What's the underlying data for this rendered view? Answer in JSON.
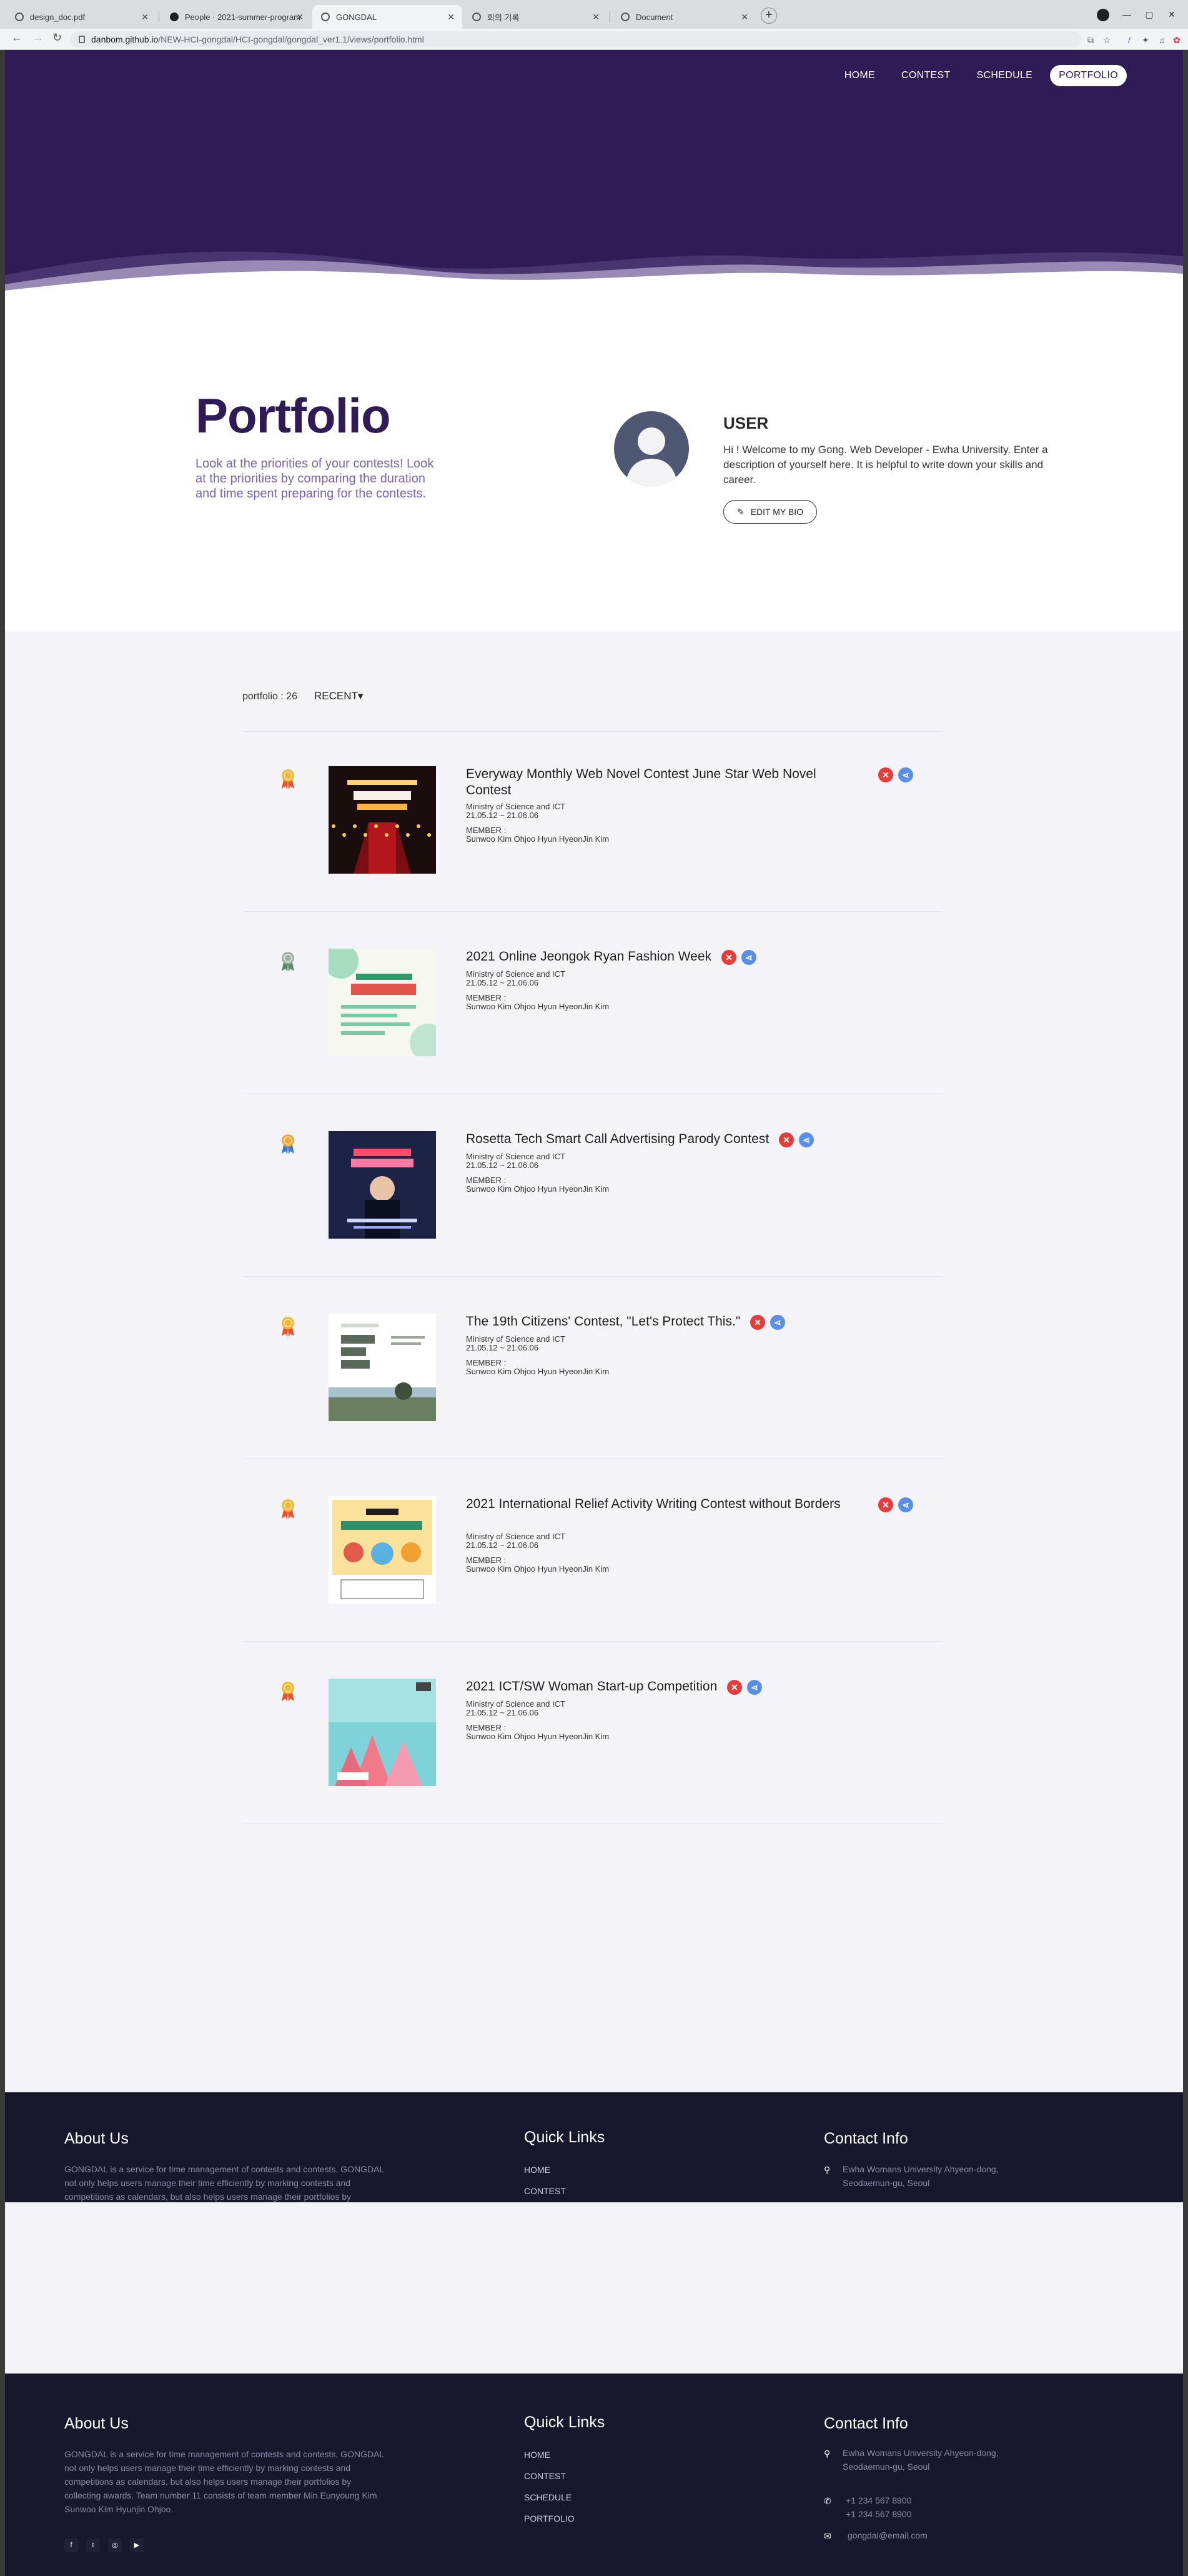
{
  "browser": {
    "tabs": [
      {
        "label": "design_doc.pdf",
        "active": false
      },
      {
        "label": "People · 2021-summer-program",
        "active": false
      },
      {
        "label": "GONGDAL",
        "active": true
      },
      {
        "label": "회의 기록",
        "active": false
      },
      {
        "label": "Document",
        "active": false
      }
    ],
    "url_host": "danbom.github.io",
    "url_path": "/NEW-HCI-gongdal/HCI-gongdal/gongdal_ver1.1/views/portfolio.html"
  },
  "nav": {
    "items": [
      "HOME",
      "CONTEST",
      "SCHEDULE",
      "PORTFOLIO"
    ],
    "active": "PORTFOLIO"
  },
  "header": {
    "title": "Portfolio",
    "description": "Look at the priorities of your contests! Look at the priorities by comparing the duration and time spent preparing for the contests."
  },
  "profile": {
    "name": "USER",
    "bio": "Hi ! Welcome to my Gong. Web Developer - Ewha University. Enter a description of yourself here. It is helpful to write down your skills and career.",
    "edit_label": "EDIT MY BIO"
  },
  "list": {
    "count_label": "portfolio : 26",
    "sort_label": "RECENT▾"
  },
  "items": [
    {
      "title": "Everyway Monthly Web Novel Contest June Star Web Novel Contest",
      "org": "Ministry of Science and ICT",
      "dates": "21.05.12 ~ 21.06.06",
      "member_label": "MEMBER :",
      "members": "Sunwoo Kim Ohjoo Hyun HyeonJin Kim",
      "medal": "gold",
      "thumb": "novel",
      "thumb_caption": "무료 웹소설 공모전"
    },
    {
      "title": "2021 Online Jeongok Ryan Fashion Week",
      "org": "Ministry of Science and ICT",
      "dates": "21.05.12 ~ 21.06.06",
      "member_label": "MEMBER :",
      "members": "Sunwoo Kim Ohjoo Hyun HyeonJin Kim",
      "medal": "silver",
      "thumb": "fashion",
      "thumb_caption": "전곡리안 패션위크"
    },
    {
      "title": "Rosetta Tech Smart Call Advertising Parody Contest",
      "org": "Ministry of Science and ICT",
      "dates": "21.05.12 ~ 21.06.06",
      "member_label": "MEMBER :",
      "members": "Sunwoo Kim Ohjoo Hyun HyeonJin Kim",
      "medal": "bronze",
      "thumb": "parody",
      "thumb_caption": "패러디 콘테스트"
    },
    {
      "title": "The 19th Citizens' Contest, \"Let's Protect This.\"",
      "org": "Ministry of Science and ICT",
      "dates": "21.05.12 ~ 21.06.06",
      "member_label": "MEMBER :",
      "members": "Sunwoo Kim Ohjoo Hyun HyeonJin Kim",
      "medal": "gold",
      "thumb": "citizens",
      "thumb_caption": "이곳만은 꼭 지키자"
    },
    {
      "title": "2021 International Relief Activity Writing Contest without Borders",
      "org": "Ministry of Science and ICT",
      "dates": "21.05.12 ~ 21.06.06",
      "member_label": "MEMBER :",
      "members": "Sunwoo Kim Ohjoo Hyun HyeonJin Kim",
      "medal": "gold",
      "thumb": "relief",
      "thumb_caption": "2021"
    },
    {
      "title": "2021 ICT/SW Woman Start-up Competition",
      "org": "Ministry of Science and ICT",
      "dates": "21.05.12 ~ 21.06.06",
      "member_label": "MEMBER :",
      "members": "Sunwoo Kim Ohjoo Hyun HyeonJin Kim",
      "medal": "gold",
      "thumb": "startup",
      "thumb_caption": "공모전"
    }
  ],
  "footer": {
    "about_title": "About Us",
    "about_text": "GONGDAL is a service for time management of contests and contests. GONGDAL not only helps users manage their time efficiently by marking contests and competitions as calendars, but also helps users manage their portfolios by collecting awards. Team number 11 consists of team member Min Eunyoung Kim Sunwoo Kim Hyunjin Ohjoo.",
    "links_title": "Quick Links",
    "links": [
      "HOME",
      "CONTEST",
      "SCHEDULE",
      "PORTFOLIO"
    ],
    "contact_title": "Contact Info",
    "address": "Ewha Womans University Ahyeon-dong, Seodaemun-gu, Seoul",
    "phone1": "+1 234 567 8900",
    "phone2": "+1 234 567 8900",
    "email": "gongdal@email.com",
    "social": [
      "facebook-icon",
      "twitter-icon",
      "instagram-icon",
      "youtube-icon"
    ]
  },
  "colors": {
    "brand": "#2f1b56",
    "accent": "#7a63b0",
    "delete": "#e53c3c",
    "share": "#5b8fe6",
    "footer": "#19172e"
  }
}
